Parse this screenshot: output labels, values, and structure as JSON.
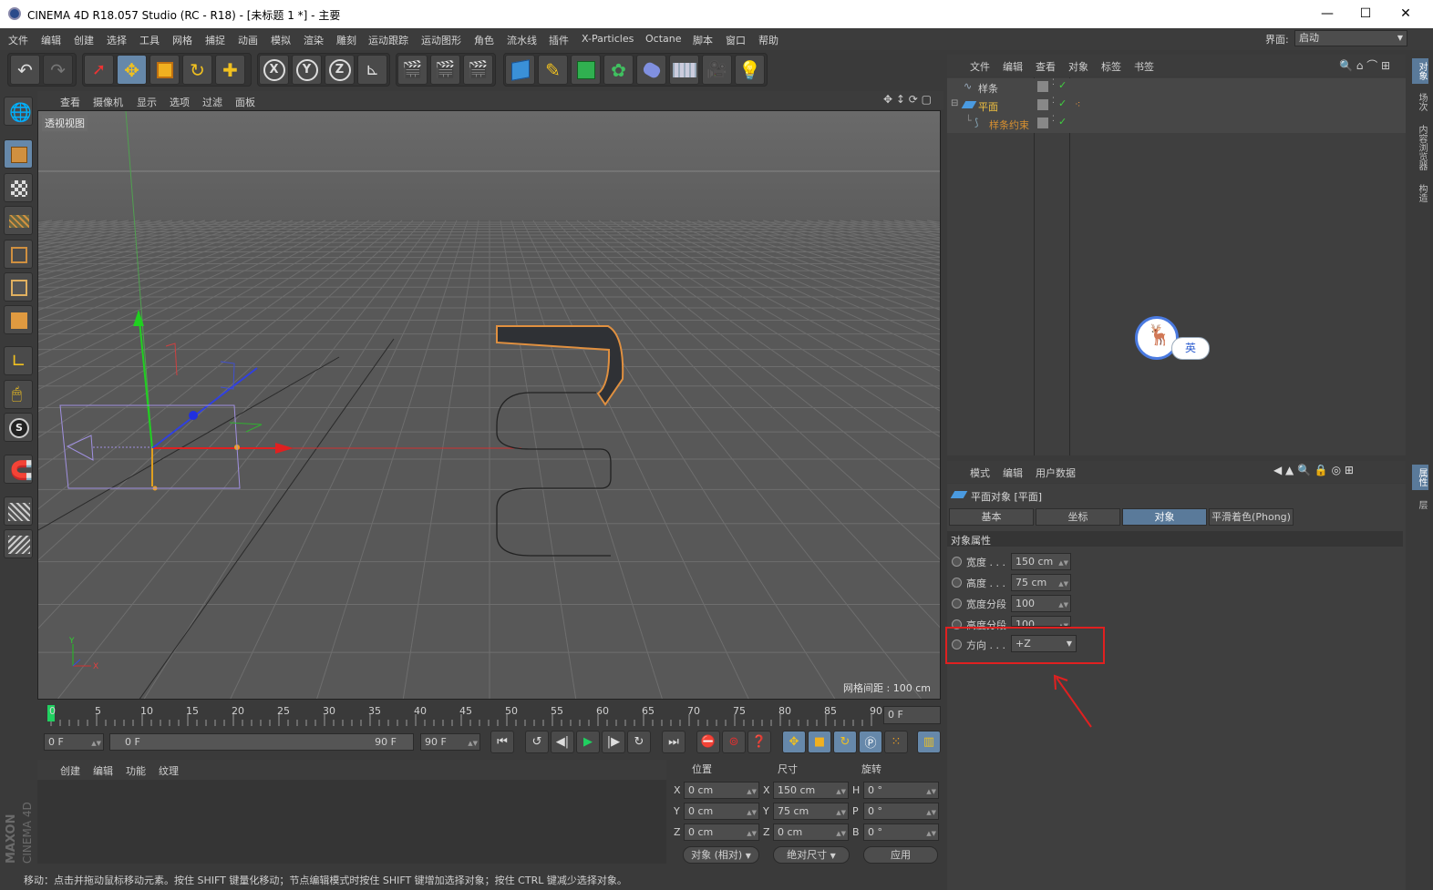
{
  "window": {
    "title": "CINEMA 4D R18.057 Studio (RC - R18) - [未标题 1 *] - 主要",
    "minimize": "—",
    "maximize": "☐",
    "close": "✕"
  },
  "menubar": {
    "items": [
      "文件",
      "编辑",
      "创建",
      "选择",
      "工具",
      "网格",
      "捕捉",
      "动画",
      "模拟",
      "渲染",
      "雕刻",
      "运动跟踪",
      "运动图形",
      "角色",
      "流水线",
      "插件",
      "X-Particles",
      "Octane",
      "脚本",
      "窗口",
      "帮助"
    ],
    "layout_label": "界面:",
    "layout_value": "启动"
  },
  "viewport": {
    "menu": [
      "查看",
      "摄像机",
      "显示",
      "选项",
      "过滤",
      "面板"
    ],
    "label": "透视视图",
    "grid_spacing": "网格间距 : 100 cm",
    "axis_y": "Y",
    "axis_x": "X"
  },
  "timeline": {
    "ticks": [
      "0",
      "5",
      "10",
      "15",
      "20",
      "25",
      "30",
      "35",
      "40",
      "45",
      "50",
      "55",
      "60",
      "65",
      "70",
      "75",
      "80",
      "85",
      "90"
    ],
    "current_frame": "0 F"
  },
  "transport": {
    "start": "0 F",
    "range_start": "0 F",
    "range_end": "90 F",
    "end": "90 F"
  },
  "material": {
    "menu": [
      "创建",
      "编辑",
      "功能",
      "纹理"
    ]
  },
  "coords": {
    "headers": [
      "位置",
      "尺寸",
      "旋转"
    ],
    "rows": [
      {
        "axis": "X",
        "pos": "0 cm",
        "size_axis": "X",
        "size": "150 cm",
        "rot_axis": "H",
        "rot": "0 °"
      },
      {
        "axis": "Y",
        "pos": "0 cm",
        "size_axis": "Y",
        "size": "75 cm",
        "rot_axis": "P",
        "rot": "0 °"
      },
      {
        "axis": "Z",
        "pos": "0 cm",
        "size_axis": "Z",
        "size": "0 cm",
        "rot_axis": "B",
        "rot": "0 °"
      }
    ],
    "mode": "对象 (相对)",
    "size_mode": "绝对尺寸",
    "apply": "应用"
  },
  "status": "移动：点击并拖动鼠标移动元素。按住 SHIFT 键量化移动；节点编辑模式时按住 SHIFT 键增加选择对象；按住 CTRL 键减少选择对象。",
  "objects": {
    "menu": [
      "文件",
      "编辑",
      "查看",
      "对象",
      "标签",
      "书签"
    ],
    "items": [
      {
        "name": "样条",
        "color": "#d0d0d0"
      },
      {
        "name": "平面",
        "color": "#f0c040"
      },
      {
        "name": "样条约束",
        "color": "#d89030"
      }
    ]
  },
  "ime": {
    "label": "英"
  },
  "right_tabs_top": [
    "对象",
    "场次",
    "内容浏览器",
    "构造"
  ],
  "right_tabs_bottom": [
    "属性",
    "层"
  ],
  "attributes": {
    "menu": [
      "模式",
      "编辑",
      "用户数据"
    ],
    "object_title": "平面对象 [平面]",
    "tabs": [
      "基本",
      "坐标",
      "对象",
      "平滑着色(Phong)"
    ],
    "section": "对象属性",
    "props": [
      {
        "label": "宽度 . . .",
        "value": "150 cm"
      },
      {
        "label": "高度 . . .",
        "value": "75 cm"
      },
      {
        "label": "宽度分段",
        "value": "100"
      },
      {
        "label": "高度分段",
        "value": "100"
      },
      {
        "label": "方向 . . .",
        "value": "+Z"
      }
    ]
  },
  "colors": {
    "accent_tab": "#5a7a9a",
    "annotation_red": "#e02020"
  }
}
